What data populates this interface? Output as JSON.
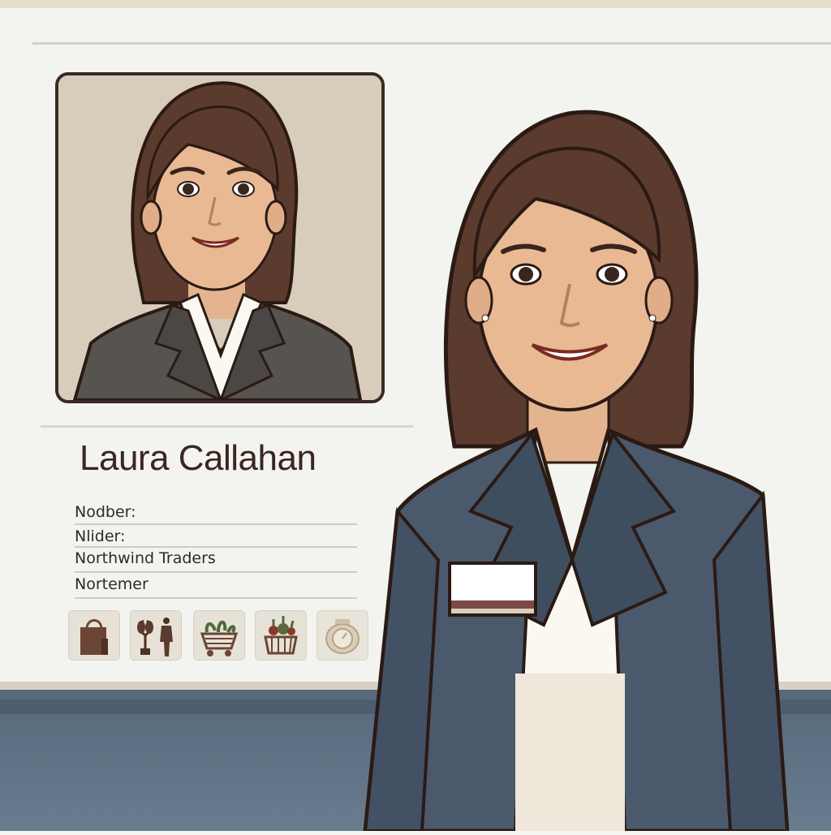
{
  "profile": {
    "name": "Laura Callahan",
    "fields": [
      {
        "label": "Nodber:"
      },
      {
        "label": "Nlider:"
      },
      {
        "label": "Northwind Traders"
      },
      {
        "label": "Nortemer"
      }
    ]
  },
  "icons": [
    "shopping-bag-icon",
    "plant-and-mannequin-icon",
    "produce-cart-icon",
    "vegetable-basket-icon",
    "scale-icon"
  ],
  "colors": {
    "wall": "#f3f4ef",
    "floor": "#56687a",
    "name_text": "#3b2622",
    "blazer": "#4a5a6c",
    "hair": "#5a3b2e"
  }
}
